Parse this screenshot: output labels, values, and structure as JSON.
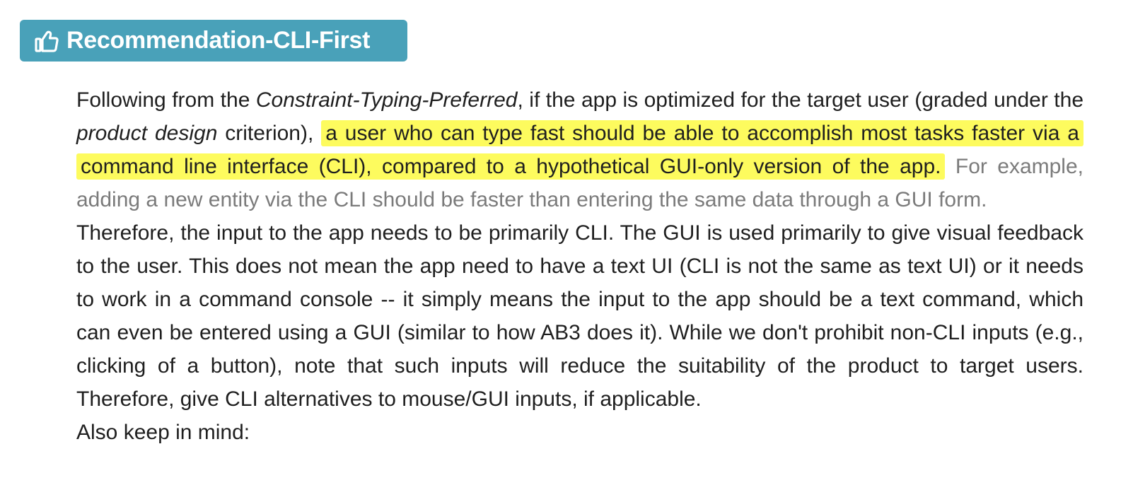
{
  "header": {
    "icon": "thumbs-up-icon",
    "title": "Recommendation-CLI-First",
    "background_color": "#49a1b9",
    "text_color": "#ffffff"
  },
  "paragraph1": {
    "text_before_ref": "Following from the ",
    "ref_constraint": "Constraint-Typing-Preferred",
    "text_after_ref": ", if the app is optimized for the target user (graded under the ",
    "ref_product_design": "product design",
    "text_after_criterion": " criterion), ",
    "highlight": "a user who can type fast should be able to accomplish most tasks faster via a command line interface (CLI), compared to a hypothetical GUI-only version of the app.",
    "example_note": "For example, adding a new entity via the CLI should be faster than entering the same data through a GUI form.",
    "highlight_color": "#fdfb5e",
    "note_color": "#7b7b7b"
  },
  "paragraph2": "Therefore, the input to the app needs to be primarily CLI. The GUI is used primarily to give visual feedback to the user. This does not mean the app need to have a text UI (CLI is not the same as text UI) or it needs to work in a command console -- it simply means the input to the app should be a text command, which can even be entered using a GUI (similar to how AB3 does it). While we don't prohibit non-CLI inputs (e.g., clicking of a button), note that such inputs will reduce the suitability of the product to target users. Therefore, give CLI alternatives to mouse/GUI inputs, if applicable.",
  "paragraph3": "Also keep in mind:"
}
